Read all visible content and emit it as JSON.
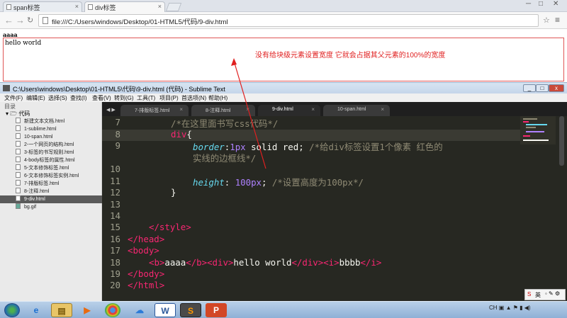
{
  "browser": {
    "tabs": [
      {
        "label": "span标签",
        "active": false
      },
      {
        "label": "div标签",
        "active": true
      }
    ],
    "close_glyph": "×",
    "window_controls": [
      "─",
      "□",
      "✕"
    ],
    "url": "file:///C:/Users/windows/Desktop/01-HTML5/代码/9-div.html"
  },
  "page": {
    "bold_text": "aaaa",
    "div_text": "hello world",
    "annotation": "没有给块级元素设置宽度 它就会占据其父元素的100%的宽度",
    "annotation_color": "#e02020"
  },
  "sublime": {
    "title": "C:\\Users\\windows\\Desktop\\01-HTML5\\代码\\9-div.html (代码) - Sublime Text",
    "menu": [
      "文件(F)",
      "编辑(E)",
      "选择(S)",
      "查找(I)",
      "查看(V)",
      "转到(G)",
      "工具(T)",
      "项目(P)",
      "首选项(N)",
      "帮助(H)"
    ],
    "sidebar_header": "目录",
    "folder": "代码",
    "files": [
      "新建文本文档.html",
      "1-sublime.html",
      "10-span.html",
      "2-一个网页的结构.html",
      "3-标签的书写规则.html",
      "4-body标签的属性.html",
      "5-文本修饰标签.html",
      "6-文本修饰标签实例.html",
      "7-排版标签.html",
      "8-注释.html",
      "9-div.html",
      "bg.gif"
    ],
    "selected_file": "9-div.html",
    "tabs": [
      "7-排版标签.html",
      "8-注释.html",
      "9-div.html",
      "10-span.html"
    ],
    "active_tab": "9-div.html",
    "line_numbers": [
      "7",
      "8",
      "9",
      "",
      "10",
      "11",
      "12",
      "13",
      "14",
      "15",
      "16",
      "17",
      "18",
      "19",
      "20"
    ],
    "code": {
      "l7": "/*在这里面书写css代码*/",
      "l8_tag": "div",
      "l8_brace": "{",
      "l9_prop": "border",
      "l9_num": "1px",
      "l9_rest": " solid red; ",
      "l9_cm": "/*给div标签设置1个像素 红色的",
      "l9_cm2": "实线的边框线*/",
      "l11_prop": "height",
      "l11_num": "100px",
      "l11_semi": "; ",
      "l11_cm": "/*设置高度为100px*/",
      "l12": "}",
      "l15": "</style>",
      "l16": "</head>",
      "l17": "<body>",
      "l18_b_open": "<b>",
      "l18_b_txt": "aaaa",
      "l18_b_close": "</b>",
      "l18_div_open": "<div>",
      "l18_div_txt": "hello world",
      "l18_div_close": "</div>",
      "l18_i_open": "<i>",
      "l18_i_txt": "bbbb",
      "l18_i_close": "</i>",
      "l19": "</body>",
      "l20": "</html>"
    }
  },
  "taskbar": {
    "tray_text": "CH",
    "ime_label": "英"
  }
}
